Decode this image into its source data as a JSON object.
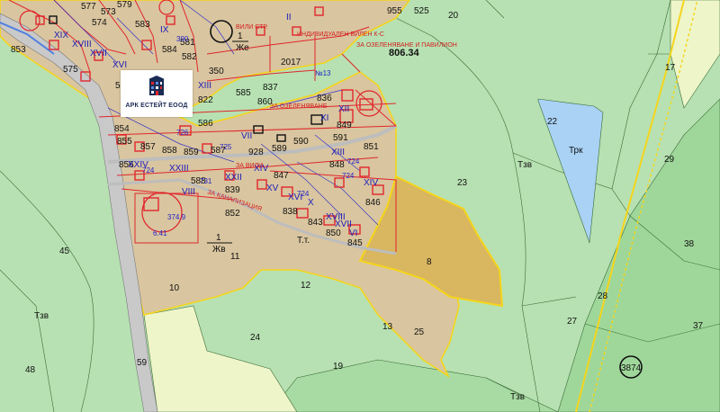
{
  "logo": {
    "text": "АРК ЕСТЕЙТ ЕООД",
    "icon": "building-logo-icon"
  },
  "colors": {
    "meadow": "#b7e1b2",
    "forest": "#9fd79a",
    "urban": "#d9c59f",
    "highlight": "#d9b660",
    "pale": "#f0f6c8",
    "lake": "#a9d2f5",
    "plot_outline": "#e0262d",
    "boundary_yellow": "#f5d51c",
    "building_blue": "#2323c8"
  },
  "zones": {
    "tzv_left": "Тзв",
    "tzv_mid": "Тзв",
    "tzv_bottom": "Тзв",
    "trk": "Трк",
    "zhv_small": "Жв",
    "zhe_top": "Же",
    "zone_one_a": "1",
    "zone_one_b": "1"
  },
  "parcels": {
    "p45": "45",
    "p48": "48",
    "p59": "59",
    "p10": "10",
    "p11": "11",
    "p12": "12",
    "p13": "13",
    "p24": "24",
    "p19": "19",
    "p25": "25",
    "p8": "8",
    "p23": "23",
    "p22": "22",
    "p17": "17",
    "p29": "29",
    "p38": "38",
    "p28": "28",
    "p27": "27",
    "p37": "37",
    "p20": "20",
    "p3874": "3874",
    "p806": "806.34",
    "p2017": "2017",
    "p853": "853"
  },
  "plots": [
    "577",
    "579",
    "574",
    "573",
    "582",
    "581",
    "350",
    "585",
    "575",
    "586",
    "597",
    "860",
    "836",
    "589",
    "590",
    "591",
    "851",
    "858",
    "859",
    "855",
    "857",
    "928",
    "837",
    "843",
    "845",
    "846",
    "849",
    "852",
    "847",
    "848",
    "839",
    "861",
    "587",
    "588",
    "583",
    "584",
    "838",
    "850",
    "822",
    "955",
    "525",
    "854",
    "856",
    "587"
  ],
  "roman": [
    "XVIII",
    "XVII",
    "XVI",
    "XIX",
    "XIII",
    "XII",
    "XI",
    "IX",
    "VII",
    "XXII",
    "XXIV",
    "XXIII",
    "XIV",
    "XV",
    "XVIII",
    "VIII",
    "XVI",
    "X",
    "XVII",
    "XIII",
    "XIV",
    "VI",
    "II"
  ],
  "red_notes": {
    "note1": "ИНДИВИДУАЛЕН ВИЛЕН К-С",
    "note2": "ЗА ОЗЕЛЕНЯВАНЕ И ПАВИЛИОН",
    "note3": "ЗА ОЗЕЛЕНЯВАНЕ",
    "note4": "ЗА ВИЛИ",
    "note5": "ВИЛИ СТР.",
    "note6": "ЗА КАНАЛИЗАЦИЯ"
  },
  "blue_values": [
    "724",
    "724",
    "726",
    "725",
    "724",
    "724",
    "731",
    "390",
    "6.41"
  ],
  "misc": {
    "tt": "Т.т.",
    "stamp": "№13",
    "ref": "374.9"
  }
}
